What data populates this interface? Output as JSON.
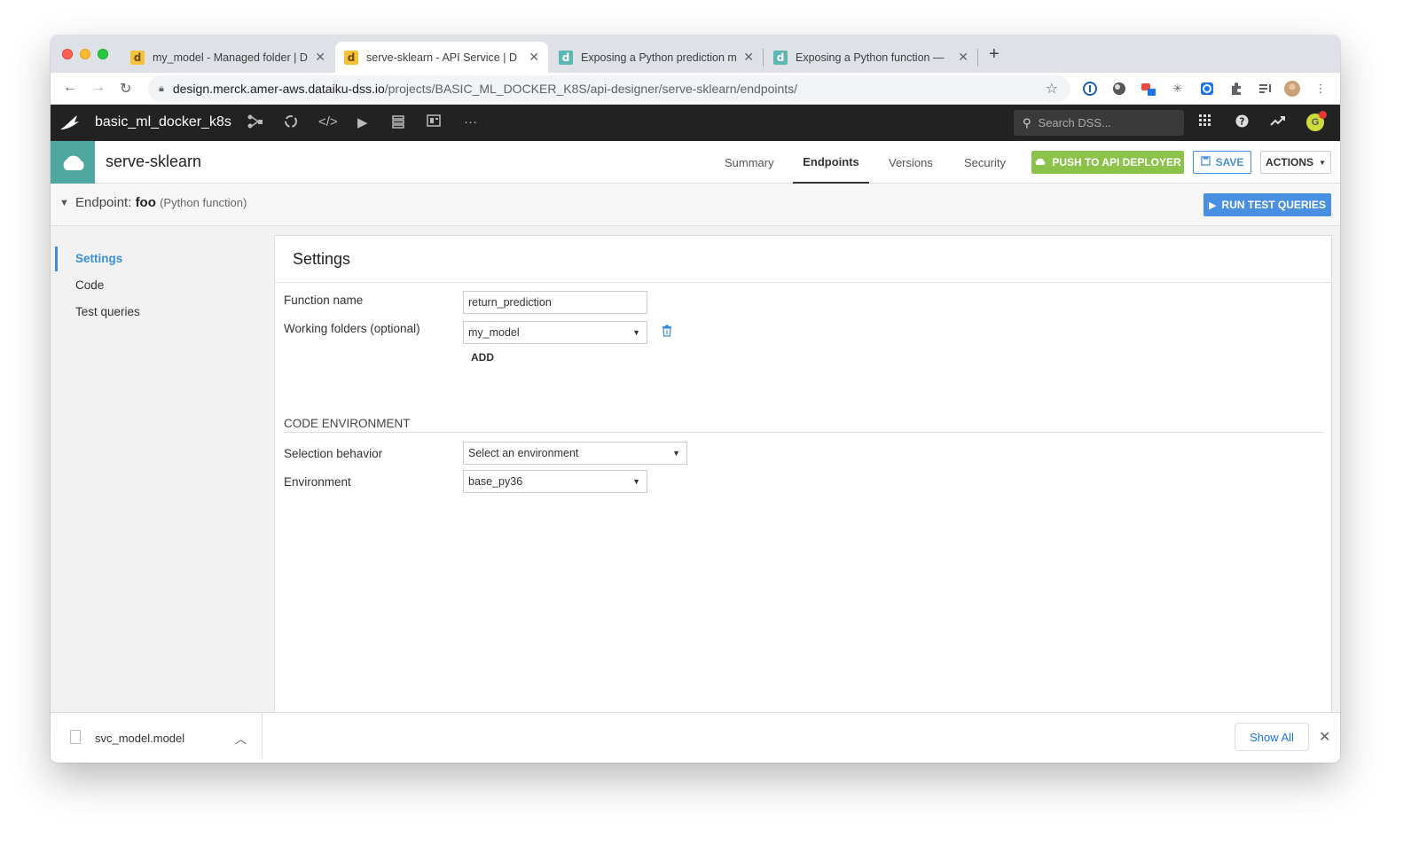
{
  "browser": {
    "tabs": [
      {
        "title": "my_model - Managed folder | D",
        "favicon": "d"
      },
      {
        "title": "serve-sklearn - API Service | D",
        "favicon": "d"
      },
      {
        "title": "Exposing a Python prediction m",
        "favicon": "d"
      },
      {
        "title": "Exposing a Python function — ",
        "favicon": "d"
      }
    ],
    "new_tab": "+",
    "close_glyph": "✕",
    "url_host": "design.merck.amer-aws.dataiku-dss.io",
    "url_path": "/projects/BASIC_ML_DOCKER_K8S/api-designer/serve-sklearn/endpoints/"
  },
  "dss_nav": {
    "project_name": "basic_ml_docker_k8s",
    "search_placeholder": "Search DSS...",
    "avatar_letter": "G",
    "more_glyph": "···"
  },
  "object_header": {
    "title": "serve-sklearn",
    "tabs": [
      "Summary",
      "Endpoints",
      "Versions",
      "Security"
    ],
    "active_tab": "Endpoints",
    "push_label": "PUSH TO API DEPLOYER",
    "save_label": "SAVE",
    "actions_label": "ACTIONS"
  },
  "endpoint": {
    "prefix": "Endpoint:",
    "name": "foo",
    "type": "(Python function)",
    "run_label": "RUN TEST QUERIES"
  },
  "sidebar": {
    "items": [
      "Settings",
      "Code",
      "Test queries"
    ],
    "active": "Settings"
  },
  "settings": {
    "title": "Settings",
    "function_name_label": "Function name",
    "function_name_value": "return_prediction",
    "working_folders_label": "Working folders (optional)",
    "working_folder_value": "my_model",
    "add_label": "ADD",
    "code_env_heading": "CODE ENVIRONMENT",
    "selection_behavior_label": "Selection behavior",
    "selection_behavior_value": "Select an environment",
    "environment_label": "Environment",
    "environment_value": "base_py36"
  },
  "download_bar": {
    "file_name": "svc_model.model",
    "show_all_label": "Show All"
  },
  "colors": {
    "accent_blue": "#3b8fd9",
    "push_green": "#8bc34a",
    "run_blue": "#4a90e2",
    "api_teal": "#4ea8a1",
    "nav_dark": "#222222"
  }
}
